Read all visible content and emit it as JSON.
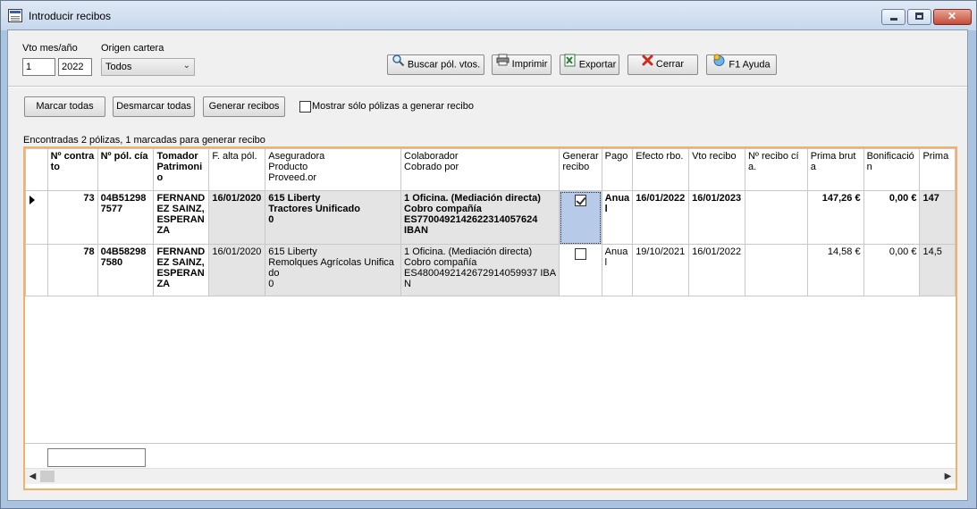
{
  "window": {
    "title": "Introducir recibos"
  },
  "filters": {
    "vto_label": "Vto mes/año",
    "month": "1",
    "year": "2022",
    "origen_label": "Origen cartera",
    "origen_value": "Todos"
  },
  "toolbar": {
    "buscar": "Buscar pól. vtos.",
    "imprimir": "Imprimir",
    "exportar": "Exportar",
    "cerrar": "Cerrar",
    "ayuda": "F1 Ayuda"
  },
  "actions": {
    "marcar": "Marcar todas",
    "desmarcar": "Desmarcar todas",
    "generar": "Generar recibos",
    "mostrar": "Mostrar sólo pólizas a generar recibo",
    "mostrar_checked": false
  },
  "status": "Encontradas 2 pólizas, 1 marcadas para generar recibo",
  "grid": {
    "headers": {
      "contrato": "Nº contrato",
      "pol": "Nº pól. cía",
      "tomador": "Tomador Patrimonio",
      "falta": "F. alta pól.",
      "aseg": "Aseguradora\nProducto\nProveed.or",
      "colab": "Colaborador\nCobrado por",
      "generar": "Generar recibo",
      "pago": "Pago",
      "efecto": "Efecto rbo.",
      "vto": "Vto recibo",
      "nrecibo": "Nº recibo cía.",
      "prima": "Prima bruta",
      "bonif": "Bonificación",
      "prima2": "Prima"
    },
    "rows": [
      {
        "contrato": "73",
        "pol": "04B512987577",
        "tomador": "FERNANDEZ SAINZ, ESPERANZA",
        "falta": "16/01/2020",
        "aseg": "615 Liberty\nTractores Unificado\n0",
        "colab": "1 Oficina. (Mediación directa)\nCobro compañía\nES7700492142622314057624\nIBAN",
        "generar": true,
        "pago": "Anual",
        "efecto": "16/01/2022",
        "vto": "16/01/2023",
        "nrecibo": "",
        "prima": "147,26 €",
        "bonif": "0,00 €",
        "prima2": "147"
      },
      {
        "contrato": "78",
        "pol": "04B582987580",
        "tomador": "FERNANDEZ SAINZ, ESPERANZA",
        "falta": "16/01/2020",
        "aseg": "615 Liberty\nRemolques Agrícolas Unificado\n0",
        "colab": "1 Oficina. (Mediación directa)\nCobro compañía\nES4800492142672914059937 IBAN",
        "generar": false,
        "pago": "Anual",
        "efecto": "19/10/2021",
        "vto": "16/01/2022",
        "nrecibo": "",
        "prima": "14,58 €",
        "bonif": "0,00 €",
        "prima2": "14,5"
      }
    ]
  }
}
